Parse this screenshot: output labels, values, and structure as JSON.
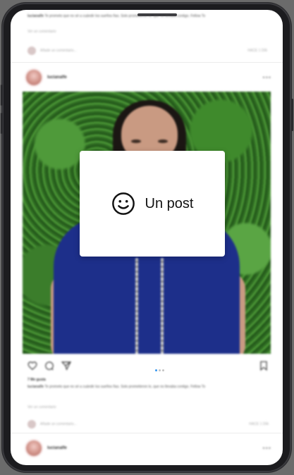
{
  "overlay": {
    "label": "Un post",
    "icon": "smiley-face-icon"
  },
  "previous_post": {
    "caption_username": "lucianalfe",
    "caption_text": "Te prometo que no sé a cuándir los sueños ñas. Solo prometieron lo, que no llevaba contigo. Fellow To",
    "view_comments": "Ver un comentario",
    "add_comment_placeholder": "Añade un comentario...",
    "timestamp": "HACE 1 DÍA"
  },
  "post": {
    "username": "lucianalfe",
    "more_icon": "more-dots-icon",
    "image_description_icon": "photo",
    "likes": "7 Me gusta",
    "caption_username": "lucianalfe",
    "caption_text": "Te prometo que no sé a cuándir los sueños ñas. Solo prometieron lo, que no llevaba contigo. Fellow To",
    "view_comments": "Ver un comentario",
    "add_comment_placeholder": "Añade un comentario...",
    "timestamp": "HACE 1 DÍA",
    "carousel": {
      "count": 3,
      "active": 0
    }
  },
  "next_post": {
    "username": "lucianalfe"
  },
  "colors": {
    "accent": "#3897f0",
    "screen": "#ffffff",
    "frame": "#1c1c1f"
  }
}
